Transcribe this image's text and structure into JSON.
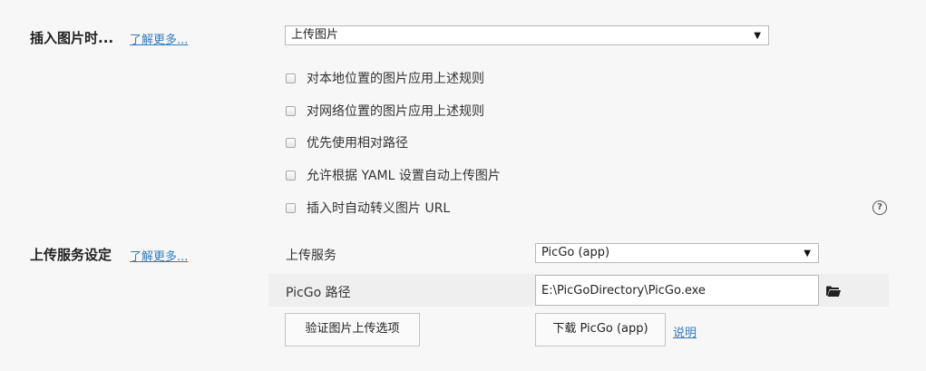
{
  "insert_image": {
    "title": "插入图片时...",
    "learn_more": "了解更多...",
    "action_select": {
      "value": "上传图片"
    },
    "options": [
      {
        "label": "对本地位置的图片应用上述规则",
        "checked": false
      },
      {
        "label": "对网络位置的图片应用上述规则",
        "checked": false
      },
      {
        "label": "优先使用相对路径",
        "checked": false
      },
      {
        "label": "允许根据 YAML 设置自动上传图片",
        "checked": false
      },
      {
        "label": "插入时自动转义图片 URL",
        "checked": false
      }
    ],
    "help_icon": "question-circle-icon",
    "help_glyph": "?"
  },
  "upload_service": {
    "title": "上传服务设定",
    "learn_more": "了解更多...",
    "service_label": "上传服务",
    "service_select": {
      "value": "PicGo (app)"
    },
    "path_label": "PicGo 路径",
    "path_value": "E:\\PicGoDirectory\\PicGo.exe",
    "folder_icon": "folder-icon",
    "verify_button": "验证图片上传选项",
    "download_button": "下载 PicGo (app)",
    "help_link": "说明"
  },
  "colors": {
    "link": "#2f7dc2",
    "background": "#f7f7f7"
  }
}
